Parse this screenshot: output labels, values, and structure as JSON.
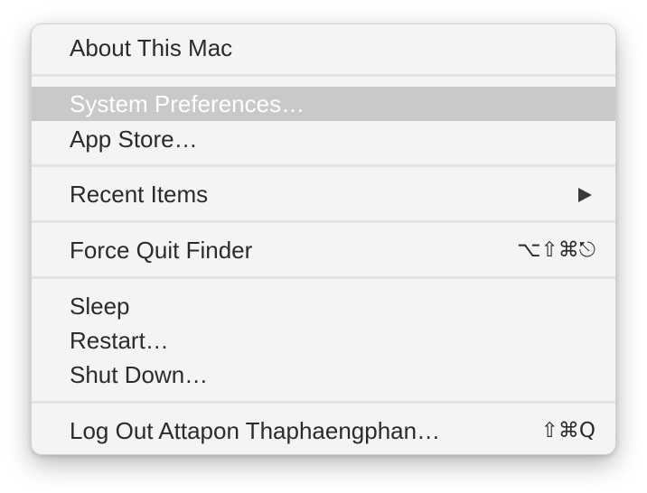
{
  "menu": {
    "about": "About This Mac",
    "system_preferences": "System Preferences…",
    "app_store": "App Store…",
    "recent_items": "Recent Items",
    "force_quit": "Force Quit Finder",
    "force_quit_shortcut": "⌥⇧⌘⎋",
    "sleep": "Sleep",
    "restart": "Restart…",
    "shut_down": "Shut Down…",
    "log_out": "Log Out Attapon Thaphaengphan…",
    "log_out_shortcut": "⇧⌘Q",
    "highlighted_item": "System Preferences…",
    "submenu_icon": "triangle-right-icon"
  }
}
